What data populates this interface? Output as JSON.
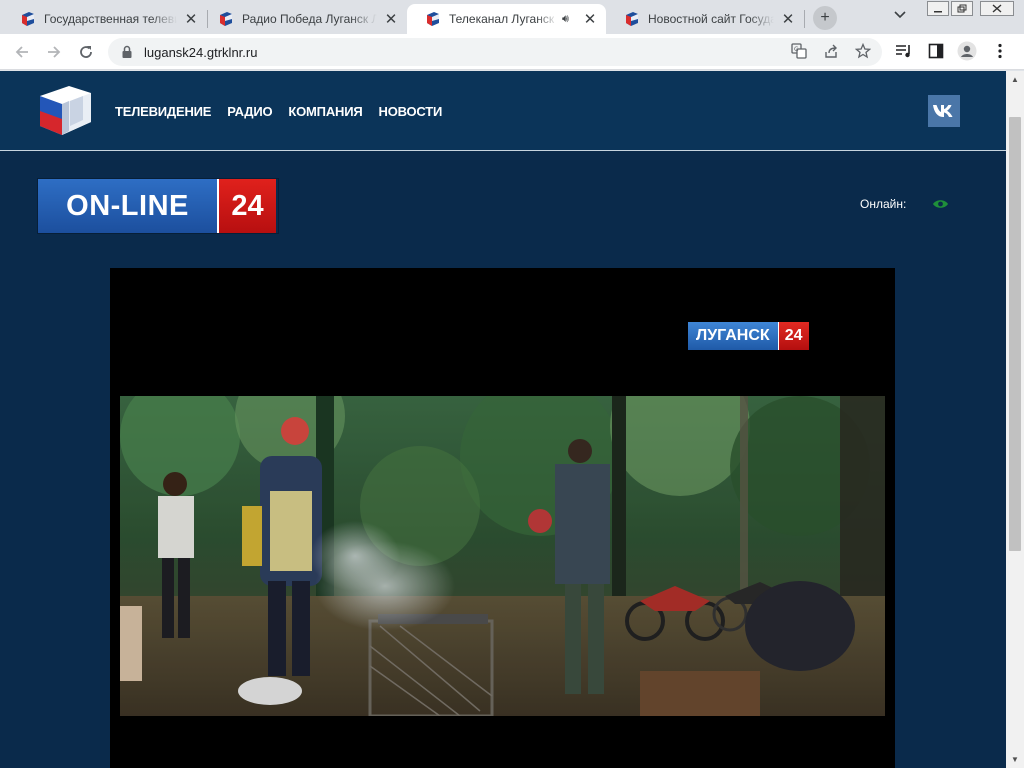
{
  "browser": {
    "tabs": [
      {
        "title": "Государственная телевизионная",
        "audio": false,
        "active": false
      },
      {
        "title": "Радио Победа Луганск Луганск",
        "audio": false,
        "active": false
      },
      {
        "title": "Телеканал Луганск 24",
        "audio": true,
        "active": true
      },
      {
        "title": "Новостной сайт Государственной",
        "audio": false,
        "active": false
      }
    ],
    "url": "lugansk24.gtrklnr.ru",
    "icons": {
      "back": "arrow-left-icon",
      "forward": "arrow-right-icon",
      "reload": "reload-icon",
      "secure": "lock-icon",
      "translate": "translate-icon",
      "share": "share-icon",
      "bookmark": "star-icon",
      "media": "media-control-icon",
      "sidepanel": "side-panel-icon",
      "profile": "profile-icon",
      "menu": "kebab-menu-icon"
    }
  },
  "site": {
    "nav": [
      "ТЕЛЕВИДЕНИЕ",
      "РАДИО",
      "КОМПАНИЯ",
      "НОВОСТИ"
    ],
    "social": "vk-icon",
    "badge": {
      "left": "ON-LINE",
      "right": "24"
    },
    "online_label": "Онлайн:",
    "player": {
      "channel_left": "ЛУГАНСК",
      "channel_right": "24"
    }
  },
  "colors": {
    "page_bg": "#0a2a4b",
    "header_bg": "#0b3459",
    "badge_blue": "#2463b8",
    "badge_red": "#cc1a16",
    "vk_blue": "#4a76a8",
    "online_green": "#1f8f3a"
  }
}
